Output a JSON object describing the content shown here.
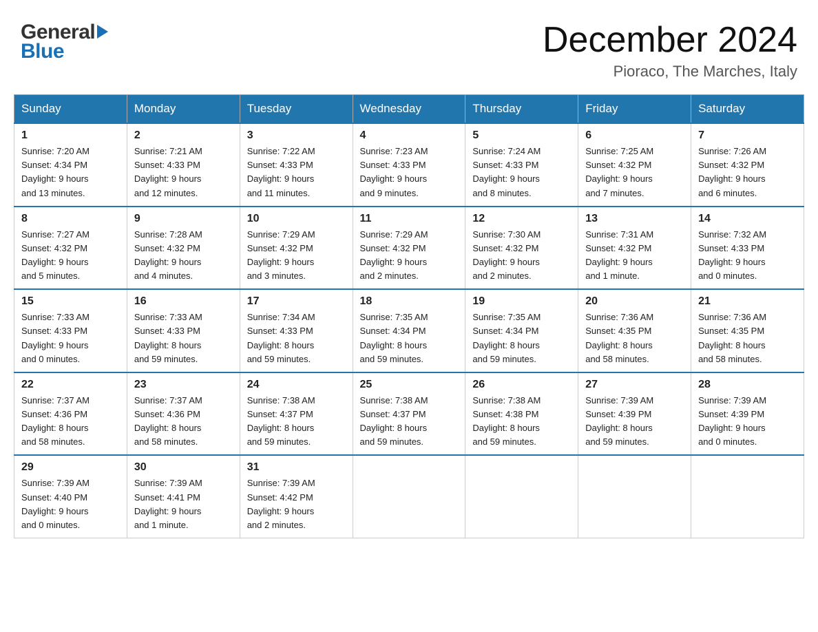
{
  "logo": {
    "general": "General",
    "arrow": "▶",
    "blue": "Blue"
  },
  "header": {
    "month_year": "December 2024",
    "location": "Pioraco, The Marches, Italy"
  },
  "days_of_week": [
    "Sunday",
    "Monday",
    "Tuesday",
    "Wednesday",
    "Thursday",
    "Friday",
    "Saturday"
  ],
  "weeks": [
    [
      {
        "day": "1",
        "sunrise": "7:20 AM",
        "sunset": "4:34 PM",
        "daylight": "9 hours and 13 minutes."
      },
      {
        "day": "2",
        "sunrise": "7:21 AM",
        "sunset": "4:33 PM",
        "daylight": "9 hours and 12 minutes."
      },
      {
        "day": "3",
        "sunrise": "7:22 AM",
        "sunset": "4:33 PM",
        "daylight": "9 hours and 11 minutes."
      },
      {
        "day": "4",
        "sunrise": "7:23 AM",
        "sunset": "4:33 PM",
        "daylight": "9 hours and 9 minutes."
      },
      {
        "day": "5",
        "sunrise": "7:24 AM",
        "sunset": "4:33 PM",
        "daylight": "9 hours and 8 minutes."
      },
      {
        "day": "6",
        "sunrise": "7:25 AM",
        "sunset": "4:32 PM",
        "daylight": "9 hours and 7 minutes."
      },
      {
        "day": "7",
        "sunrise": "7:26 AM",
        "sunset": "4:32 PM",
        "daylight": "9 hours and 6 minutes."
      }
    ],
    [
      {
        "day": "8",
        "sunrise": "7:27 AM",
        "sunset": "4:32 PM",
        "daylight": "9 hours and 5 minutes."
      },
      {
        "day": "9",
        "sunrise": "7:28 AM",
        "sunset": "4:32 PM",
        "daylight": "9 hours and 4 minutes."
      },
      {
        "day": "10",
        "sunrise": "7:29 AM",
        "sunset": "4:32 PM",
        "daylight": "9 hours and 3 minutes."
      },
      {
        "day": "11",
        "sunrise": "7:29 AM",
        "sunset": "4:32 PM",
        "daylight": "9 hours and 2 minutes."
      },
      {
        "day": "12",
        "sunrise": "7:30 AM",
        "sunset": "4:32 PM",
        "daylight": "9 hours and 2 minutes."
      },
      {
        "day": "13",
        "sunrise": "7:31 AM",
        "sunset": "4:32 PM",
        "daylight": "9 hours and 1 minute."
      },
      {
        "day": "14",
        "sunrise": "7:32 AM",
        "sunset": "4:33 PM",
        "daylight": "9 hours and 0 minutes."
      }
    ],
    [
      {
        "day": "15",
        "sunrise": "7:33 AM",
        "sunset": "4:33 PM",
        "daylight": "9 hours and 0 minutes."
      },
      {
        "day": "16",
        "sunrise": "7:33 AM",
        "sunset": "4:33 PM",
        "daylight": "8 hours and 59 minutes."
      },
      {
        "day": "17",
        "sunrise": "7:34 AM",
        "sunset": "4:33 PM",
        "daylight": "8 hours and 59 minutes."
      },
      {
        "day": "18",
        "sunrise": "7:35 AM",
        "sunset": "4:34 PM",
        "daylight": "8 hours and 59 minutes."
      },
      {
        "day": "19",
        "sunrise": "7:35 AM",
        "sunset": "4:34 PM",
        "daylight": "8 hours and 59 minutes."
      },
      {
        "day": "20",
        "sunrise": "7:36 AM",
        "sunset": "4:35 PM",
        "daylight": "8 hours and 58 minutes."
      },
      {
        "day": "21",
        "sunrise": "7:36 AM",
        "sunset": "4:35 PM",
        "daylight": "8 hours and 58 minutes."
      }
    ],
    [
      {
        "day": "22",
        "sunrise": "7:37 AM",
        "sunset": "4:36 PM",
        "daylight": "8 hours and 58 minutes."
      },
      {
        "day": "23",
        "sunrise": "7:37 AM",
        "sunset": "4:36 PM",
        "daylight": "8 hours and 58 minutes."
      },
      {
        "day": "24",
        "sunrise": "7:38 AM",
        "sunset": "4:37 PM",
        "daylight": "8 hours and 59 minutes."
      },
      {
        "day": "25",
        "sunrise": "7:38 AM",
        "sunset": "4:37 PM",
        "daylight": "8 hours and 59 minutes."
      },
      {
        "day": "26",
        "sunrise": "7:38 AM",
        "sunset": "4:38 PM",
        "daylight": "8 hours and 59 minutes."
      },
      {
        "day": "27",
        "sunrise": "7:39 AM",
        "sunset": "4:39 PM",
        "daylight": "8 hours and 59 minutes."
      },
      {
        "day": "28",
        "sunrise": "7:39 AM",
        "sunset": "4:39 PM",
        "daylight": "9 hours and 0 minutes."
      }
    ],
    [
      {
        "day": "29",
        "sunrise": "7:39 AM",
        "sunset": "4:40 PM",
        "daylight": "9 hours and 0 minutes."
      },
      {
        "day": "30",
        "sunrise": "7:39 AM",
        "sunset": "4:41 PM",
        "daylight": "9 hours and 1 minute."
      },
      {
        "day": "31",
        "sunrise": "7:39 AM",
        "sunset": "4:42 PM",
        "daylight": "9 hours and 2 minutes."
      },
      null,
      null,
      null,
      null
    ]
  ],
  "labels": {
    "sunrise": "Sunrise:",
    "sunset": "Sunset:",
    "daylight": "Daylight:"
  }
}
